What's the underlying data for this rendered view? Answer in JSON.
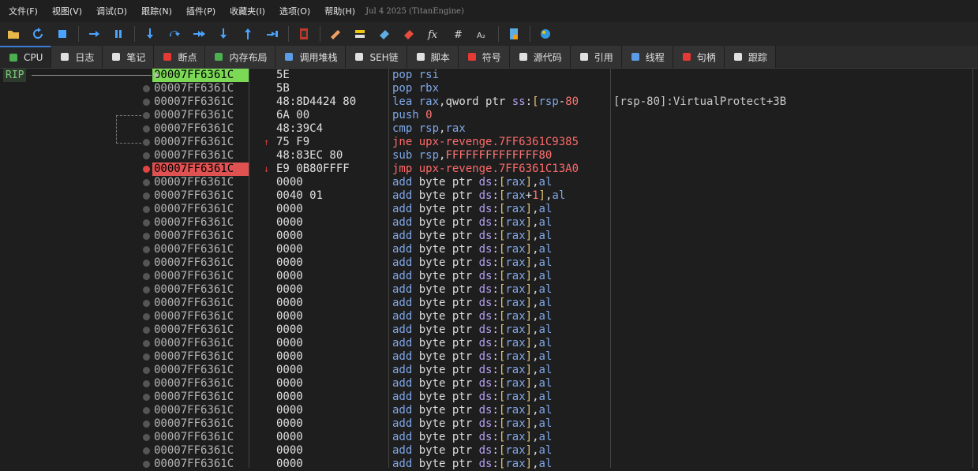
{
  "menu": [
    "文件(F)",
    "视图(V)",
    "调试(D)",
    "跟踪(N)",
    "插件(P)",
    "收藏夹(I)",
    "选项(O)",
    "帮助(H)"
  ],
  "build_info": "Jul 4 2025 (TitanEngine)",
  "toolbar": [
    "open-icon",
    "restart-icon",
    "stop-icon",
    "run-icon",
    "pause-icon",
    "step-into-icon",
    "step-over-icon",
    "trace-into-icon",
    "trace-over-icon",
    "execute-till-return-icon",
    "run-to-user-code-icon",
    "scylla-icon",
    "patch-icon",
    "comments-icon",
    "labels-icon",
    "bookmarks-icon",
    "functions-icon",
    "variables-icon",
    "calculator-icon",
    "notes-icon",
    "favorites-icon"
  ],
  "tabs": [
    {
      "label": "CPU",
      "icon": "cpu-icon",
      "color": "#4caf50"
    },
    {
      "label": "日志",
      "icon": "log-icon",
      "color": "#e0e0e0"
    },
    {
      "label": "笔记",
      "icon": "notes-icon",
      "color": "#e0e0e0"
    },
    {
      "label": "断点",
      "icon": "breakpoint-icon",
      "color": "#e53935"
    },
    {
      "label": "内存布局",
      "icon": "memory-icon",
      "color": "#4caf50"
    },
    {
      "label": "调用堆栈",
      "icon": "callstack-icon",
      "color": "#5c9ce6"
    },
    {
      "label": "SEH链",
      "icon": "seh-icon",
      "color": "#e0e0e0"
    },
    {
      "label": "脚本",
      "icon": "script-icon",
      "color": "#e0e0e0"
    },
    {
      "label": "符号",
      "icon": "symbols-icon",
      "color": "#e53935"
    },
    {
      "label": "源代码",
      "icon": "source-icon",
      "color": "#e0e0e0"
    },
    {
      "label": "引用",
      "icon": "references-icon",
      "color": "#e0e0e0"
    },
    {
      "label": "线程",
      "icon": "threads-icon",
      "color": "#5c9ce6"
    },
    {
      "label": "句柄",
      "icon": "handles-icon",
      "color": "#e53935"
    },
    {
      "label": "跟踪",
      "icon": "trace-icon",
      "color": "#e0e0e0"
    }
  ],
  "rip_label": "RIP",
  "rows": [
    {
      "addr": "00007FF6361C",
      "bytes": "5E",
      "mn": "pop",
      "ops": "rsi",
      "state": "current"
    },
    {
      "addr": "00007FF6361C",
      "bytes": "5B",
      "mn": "pop",
      "ops": "rbx"
    },
    {
      "addr": "00007FF6361C",
      "bytes": "48:8D4424 80",
      "mn": "lea",
      "ops": "rax,qword ptr ss:[rsp-80",
      "comment": "[rsp-80]:VirtualProtect+3B"
    },
    {
      "addr": "00007FF6361C",
      "bytes": "6A 00",
      "mn": "push",
      "ops": "0"
    },
    {
      "addr": "00007FF6361C",
      "bytes": "48:39C4",
      "mn": "cmp",
      "ops": "rsp,rax"
    },
    {
      "addr": "00007FF6361C",
      "bytes": "75 F9",
      "mn": "jne",
      "ops": "upx-revenge.7FF6361C9385",
      "jump": "↑"
    },
    {
      "addr": "00007FF6361C",
      "bytes": "48:83EC 80",
      "mn": "sub",
      "ops": "rsp,FFFFFFFFFFFFFF80"
    },
    {
      "addr": "00007FF6361C",
      "bytes": "E9 0B80FFFF",
      "mn": "jmp",
      "ops": "upx-revenge.7FF6361C13A0",
      "state": "breakpoint",
      "jump": "↓"
    },
    {
      "addr": "00007FF6361C",
      "bytes": "0000",
      "mn": "add",
      "ops": "byte ptr ds:[rax],al"
    },
    {
      "addr": "00007FF6361C",
      "bytes": "0040 01",
      "mn": "add",
      "ops": "byte ptr ds:[rax+1],al"
    },
    {
      "addr": "00007FF6361C",
      "bytes": "0000",
      "mn": "add",
      "ops": "byte ptr ds:[rax],al"
    },
    {
      "addr": "00007FF6361C",
      "bytes": "0000",
      "mn": "add",
      "ops": "byte ptr ds:[rax],al"
    },
    {
      "addr": "00007FF6361C",
      "bytes": "0000",
      "mn": "add",
      "ops": "byte ptr ds:[rax],al"
    },
    {
      "addr": "00007FF6361C",
      "bytes": "0000",
      "mn": "add",
      "ops": "byte ptr ds:[rax],al"
    },
    {
      "addr": "00007FF6361C",
      "bytes": "0000",
      "mn": "add",
      "ops": "byte ptr ds:[rax],al"
    },
    {
      "addr": "00007FF6361C",
      "bytes": "0000",
      "mn": "add",
      "ops": "byte ptr ds:[rax],al"
    },
    {
      "addr": "00007FF6361C",
      "bytes": "0000",
      "mn": "add",
      "ops": "byte ptr ds:[rax],al"
    },
    {
      "addr": "00007FF6361C",
      "bytes": "0000",
      "mn": "add",
      "ops": "byte ptr ds:[rax],al"
    },
    {
      "addr": "00007FF6361C",
      "bytes": "0000",
      "mn": "add",
      "ops": "byte ptr ds:[rax],al"
    },
    {
      "addr": "00007FF6361C",
      "bytes": "0000",
      "mn": "add",
      "ops": "byte ptr ds:[rax],al"
    },
    {
      "addr": "00007FF6361C",
      "bytes": "0000",
      "mn": "add",
      "ops": "byte ptr ds:[rax],al"
    },
    {
      "addr": "00007FF6361C",
      "bytes": "0000",
      "mn": "add",
      "ops": "byte ptr ds:[rax],al"
    },
    {
      "addr": "00007FF6361C",
      "bytes": "0000",
      "mn": "add",
      "ops": "byte ptr ds:[rax],al"
    },
    {
      "addr": "00007FF6361C",
      "bytes": "0000",
      "mn": "add",
      "ops": "byte ptr ds:[rax],al"
    },
    {
      "addr": "00007FF6361C",
      "bytes": "0000",
      "mn": "add",
      "ops": "byte ptr ds:[rax],al"
    },
    {
      "addr": "00007FF6361C",
      "bytes": "0000",
      "mn": "add",
      "ops": "byte ptr ds:[rax],al"
    },
    {
      "addr": "00007FF6361C",
      "bytes": "0000",
      "mn": "add",
      "ops": "byte ptr ds:[rax],al"
    },
    {
      "addr": "00007FF6361C",
      "bytes": "0000",
      "mn": "add",
      "ops": "byte ptr ds:[rax],al"
    },
    {
      "addr": "00007FF6361C",
      "bytes": "0000",
      "mn": "add",
      "ops": "byte ptr ds:[rax],al"
    },
    {
      "addr": "00007FF6361C",
      "bytes": "0000",
      "mn": "add",
      "ops": "byte ptr ds:[rax],al"
    }
  ]
}
